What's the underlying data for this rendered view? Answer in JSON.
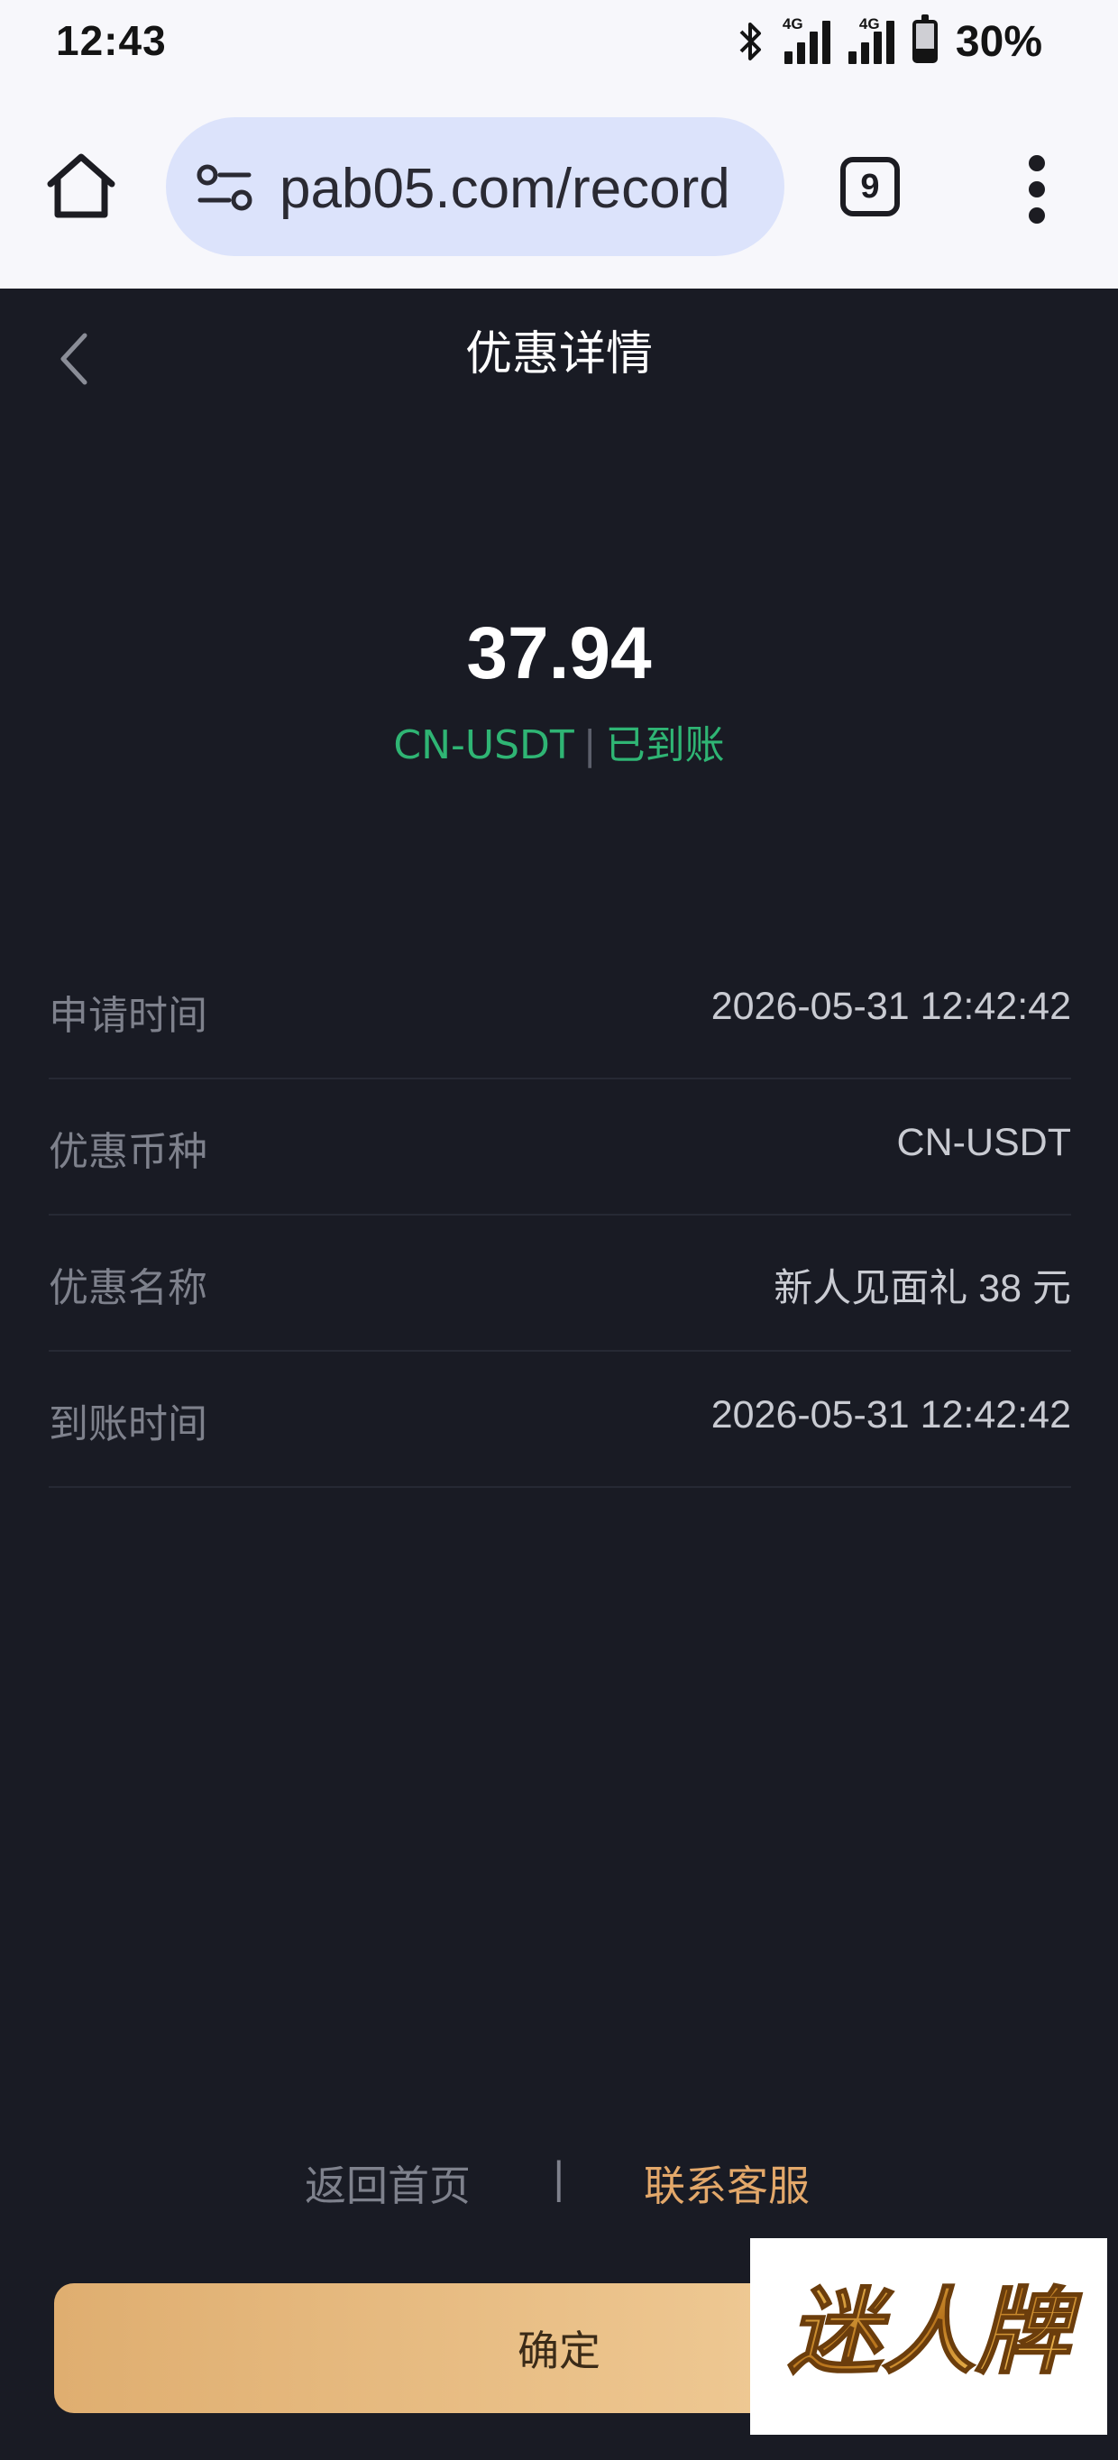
{
  "status_bar": {
    "time": "12:43",
    "network_1": "4G",
    "network_2": "4G",
    "battery": "30%",
    "battery_level": 0.3
  },
  "browser": {
    "url": "pab05.com/record",
    "tab_count": "9"
  },
  "header": {
    "title": "优惠详情"
  },
  "summary": {
    "amount": "37.94",
    "currency": "CN-USDT",
    "separator": "|",
    "status": "已到账"
  },
  "details": [
    {
      "label": "申请时间",
      "value": "2026-05-31 12:42:42"
    },
    {
      "label": "优惠币种",
      "value": "CN-USDT"
    },
    {
      "label": "优惠名称",
      "value": "新人见面礼 38 元"
    },
    {
      "label": "到账时间",
      "value": "2026-05-31 12:42:42"
    }
  ],
  "footer": {
    "home_link": "返回首页",
    "separator": "|",
    "service_link": "联系客服",
    "confirm": "确定"
  },
  "watermark": {
    "text": "迷人牌"
  },
  "colors": {
    "background": "#191b24",
    "status_green": "#2fb574",
    "accent_gold": "#e3a86a",
    "button_gold": "#ecc48d"
  }
}
